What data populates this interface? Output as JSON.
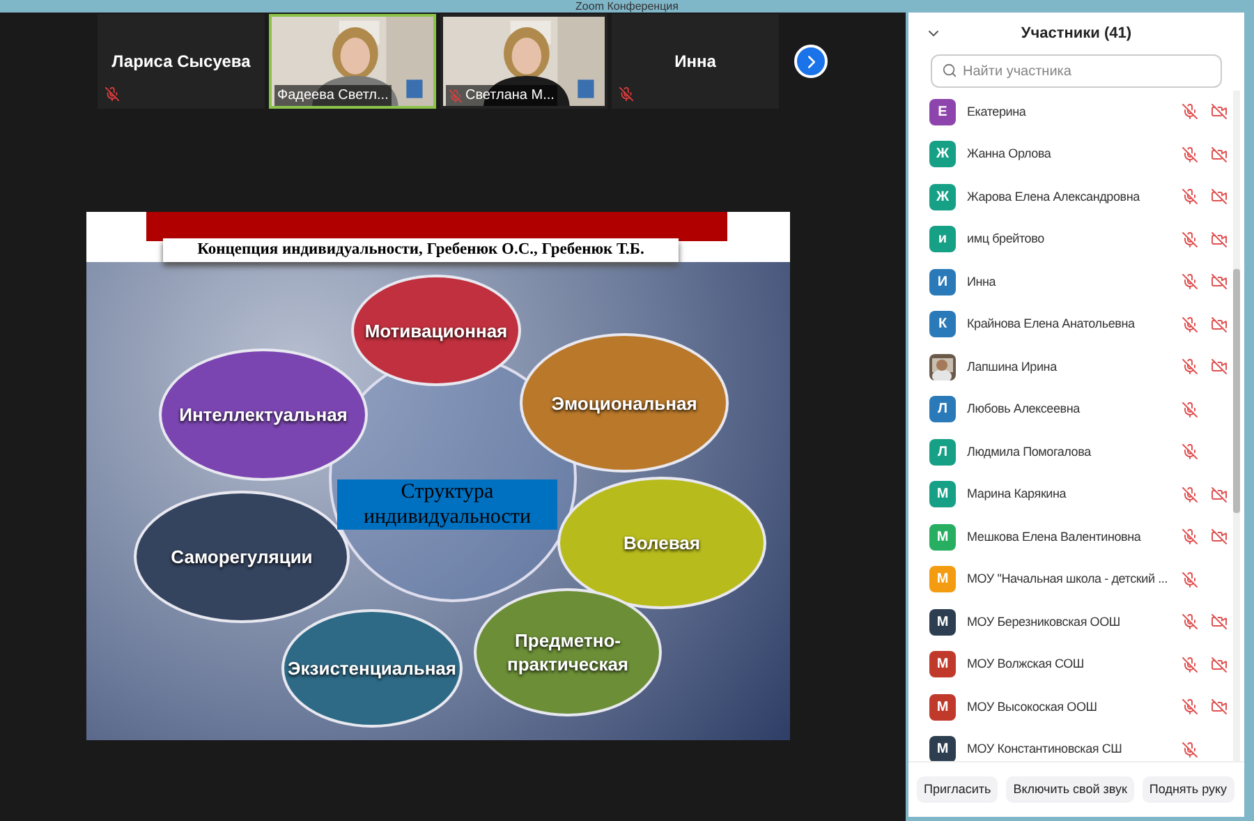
{
  "window": {
    "title": "Zoom Конференция"
  },
  "video_strip": [
    {
      "kind": "name",
      "name": "Лариса Сысуева",
      "muted": true,
      "selected": false
    },
    {
      "kind": "video",
      "name": "Фадеева Светл...",
      "muted": false,
      "selected": true
    },
    {
      "kind": "video",
      "name": "Светлана М...",
      "muted": true,
      "selected": false
    },
    {
      "kind": "name",
      "name": "Инна",
      "muted": true,
      "selected": false
    }
  ],
  "slide": {
    "title": "Концепция индивидуальности, Гребенюк О.С., Гребенюк Т.Б.",
    "center": "Структура индивидуальности",
    "bubbles": [
      {
        "label": "Мотивационная",
        "color": "#c0303e"
      },
      {
        "label": "Эмоциональная",
        "color": "#b9782a"
      },
      {
        "label": "Интеллектуальная",
        "color": "#7a45b0"
      },
      {
        "label": "Волевая",
        "color": "#b8bb1c"
      },
      {
        "label": "Саморегуляции",
        "color": "#34435e"
      },
      {
        "label": "Экзистенциальная",
        "color": "#2e6a86"
      },
      {
        "label": "Предметно-практическая",
        "color": "#6b8e36"
      }
    ]
  },
  "participants": {
    "title": "Участники (41)",
    "search": {
      "placeholder": "Найти участника"
    },
    "items": [
      {
        "initial": "Е",
        "name": "Екатерина",
        "color": "#8e44ad",
        "muted": true,
        "video_off": true
      },
      {
        "initial": "Ж",
        "name": "Жанна Орлова",
        "color": "#16a085",
        "muted": true,
        "video_off": true
      },
      {
        "initial": "Ж",
        "name": "Жарова Елена Александровна",
        "color": "#16a085",
        "muted": true,
        "video_off": true
      },
      {
        "initial": "и",
        "name": "имц брейтово",
        "color": "#16a085",
        "muted": true,
        "video_off": true
      },
      {
        "initial": "И",
        "name": "Инна",
        "color": "#2a7ab9",
        "muted": true,
        "video_off": true
      },
      {
        "initial": "К",
        "name": "Крайнова Елена Анатольевна",
        "color": "#2a7ab9",
        "muted": true,
        "video_off": true
      },
      {
        "kind": "picture",
        "name": "Лапшина Ирина",
        "muted": true,
        "video_off": true
      },
      {
        "initial": "Л",
        "name": "Любовь Алексеевна",
        "color": "#2a7ab9",
        "muted": true,
        "video_off": false
      },
      {
        "initial": "Л",
        "name": "Людмила Помогалова",
        "color": "#16a085",
        "muted": true,
        "video_off": false
      },
      {
        "initial": "М",
        "name": "Марина Карякина",
        "color": "#16a085",
        "muted": true,
        "video_off": true
      },
      {
        "initial": "М",
        "name": "Мешкова Елена Валентиновна",
        "color": "#27ae60",
        "muted": true,
        "video_off": true
      },
      {
        "initial": "М",
        "name": "МОУ \"Начальная школа - детский ...",
        "color": "#f39c12",
        "muted": true,
        "video_off": false
      },
      {
        "initial": "М",
        "name": "МОУ Березниковская ООШ",
        "color": "#2c3e50",
        "muted": true,
        "video_off": true
      },
      {
        "initial": "М",
        "name": "МОУ Волжская СОШ",
        "color": "#c0392b",
        "muted": true,
        "video_off": true
      },
      {
        "initial": "М",
        "name": "МОУ Высокоская ООШ",
        "color": "#c0392b",
        "muted": true,
        "video_off": true
      },
      {
        "initial": "М",
        "name": "МОУ Константиновская СШ",
        "color": "#2c3e50",
        "muted": true,
        "video_off": false
      }
    ],
    "buttons": [
      "Пригласить",
      "Включить свой звук",
      "Поднять руку"
    ]
  }
}
